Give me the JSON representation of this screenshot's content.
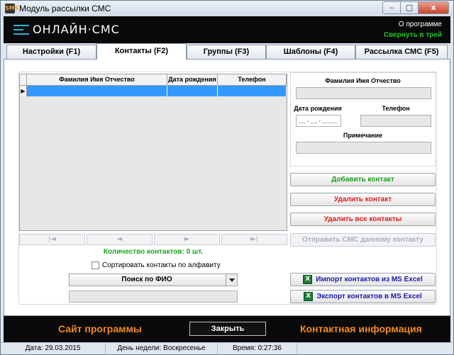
{
  "window": {
    "title": "Модуль рассылки СМС",
    "icon_label": "SMS",
    "controls": {
      "minimize": "–",
      "maximize": "□",
      "close": "x"
    }
  },
  "header": {
    "logo_text": "ОНЛАЙН·СМС",
    "about_link": "О программе",
    "tray_link": "Свернуть в трей",
    "accent_color": "#2fb3d9"
  },
  "tabs": [
    {
      "label": "Настройки (F1)"
    },
    {
      "label": "Контакты (F2)",
      "active": true
    },
    {
      "label": "Группы (F3)"
    },
    {
      "label": "Шаблоны (F4)"
    },
    {
      "label": "Рассылка СМС (F5)"
    }
  ],
  "contacts_grid": {
    "columns": [
      "Фамилия Имя Отчество",
      "Дата рождения",
      "Телефон"
    ],
    "rows": [
      {
        "name": "",
        "birthdate": "",
        "phone": ""
      }
    ],
    "row_indicator": "▶",
    "nav_buttons": [
      "|◄",
      "◄",
      "►",
      "►|"
    ]
  },
  "contacts_count": "Количество контактов: 0 шт.",
  "sort_checkbox": {
    "label": "Сортировать контакты по алфавиту",
    "checked": false
  },
  "search": {
    "mode": "Поиск по ФИО",
    "value": ""
  },
  "details": {
    "name_label": "Фамилия Имя Отчество",
    "name_value": "",
    "birthdate_label": "Дата рождения",
    "birthdate_value": "__.__.____",
    "phone_label": "Телефон",
    "phone_value": "",
    "note_label": "Примечание",
    "note_value": ""
  },
  "actions": {
    "add": "Добавить контакт",
    "delete": "Удалить контакт",
    "delete_all": "Удалить все контакты",
    "send_sms": "Отправить СМС данному контакту",
    "import_excel": "Импорт контактов из MS Excel",
    "export_excel": "Экспорт контактов в MS Excel",
    "excel_icon": "X"
  },
  "footer": {
    "site_link": "Сайт программы",
    "close_button": "Закрыть",
    "contact_link": "Контактная информация",
    "link_color": "#f28a1e"
  },
  "status": {
    "date": "Дата: 29.03.2015",
    "weekday": "День недели: Воскресенье",
    "time": "Время: 0:27:36"
  }
}
